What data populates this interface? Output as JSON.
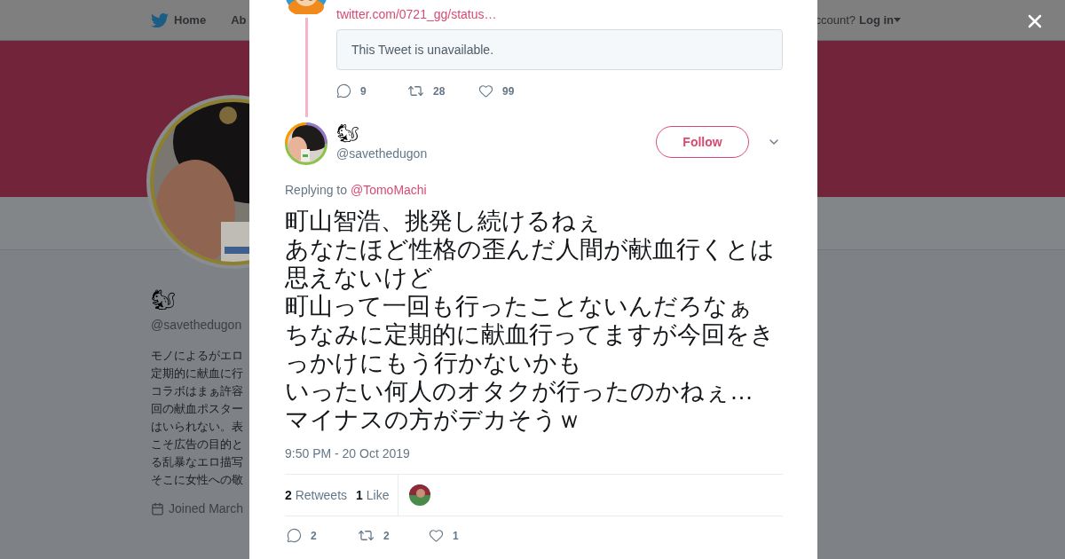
{
  "nav": {
    "items": [
      {
        "label": "Home",
        "kind": "home"
      },
      {
        "label": "Ab",
        "kind": "plain"
      }
    ],
    "account_prompt": "ccount?",
    "login": "Log in"
  },
  "profile": {
    "name": "🐿",
    "handle": "@savethedugon",
    "bio_lines": [
      "モノによるがエロ",
      "定期的に献血に行",
      "コラボはまぁ許容",
      "回の献血ポスター",
      "はいられない。表",
      "こそ広告の目的と",
      "る乱暴なエロ描写",
      "そこに女性への敬"
    ],
    "joined": "Joined March"
  },
  "thread": {
    "link": "twitter.com/0721_gg/status…",
    "quote": "This Tweet is unavailable.",
    "actions": [
      {
        "kind": "reply",
        "count": "9"
      },
      {
        "kind": "retweet",
        "count": "28"
      },
      {
        "kind": "like",
        "count": "99"
      }
    ]
  },
  "tweet": {
    "name": "🐿",
    "handle": "@savethedugon",
    "follow": "Follow",
    "replying_label": "Replying to",
    "replying_to": "@TomoMachi",
    "text_lines": [
      "町山智浩、挑発し続けるねぇ",
      "あなたほど性格の歪んだ人間が献血行くとは思えないけど",
      "町山って一回も行ったことないんだろなぁ",
      "ちなみに定期的に献血行ってますが今回をきっかけにもう行かないかも",
      "いったい何人のオタクが行ったのかねぇ…",
      "マイナスの方がデカそうｗ"
    ],
    "time": "9:50 PM - 20 Oct 2019",
    "stats": [
      {
        "count": "2",
        "label": "Retweets"
      },
      {
        "count": "1",
        "label": "Like"
      }
    ],
    "actions": [
      {
        "kind": "reply",
        "count": "2"
      },
      {
        "kind": "retweet",
        "count": "2"
      },
      {
        "kind": "like",
        "count": "1"
      }
    ]
  }
}
